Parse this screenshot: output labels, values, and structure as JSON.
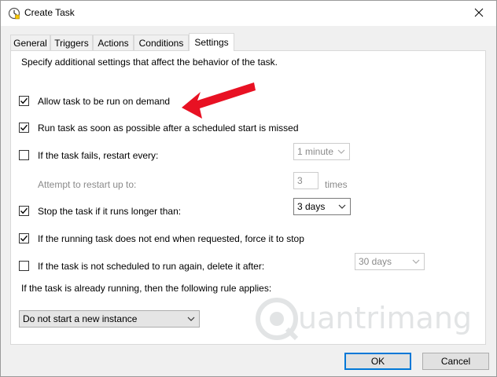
{
  "window": {
    "title": "Create Task",
    "title_icon": "clock-icon",
    "close_icon": "close-icon"
  },
  "tabs": [
    {
      "label": "General",
      "active": false
    },
    {
      "label": "Triggers",
      "active": false
    },
    {
      "label": "Actions",
      "active": false
    },
    {
      "label": "Conditions",
      "active": false
    },
    {
      "label": "Settings",
      "active": true
    }
  ],
  "settings": {
    "intro": "Specify additional settings that affect the behavior of the task.",
    "allow_on_demand": {
      "label": "Allow task to be run on demand",
      "checked": true
    },
    "run_asap": {
      "label": "Run task as soon as possible after a scheduled start is missed",
      "checked": true
    },
    "restart_on_fail": {
      "label": "If the task fails, restart every:",
      "checked": false,
      "interval": "1 minute"
    },
    "restart_attempts": {
      "label": "Attempt to restart up to:",
      "value": "3",
      "unit": "times"
    },
    "stop_if_longer": {
      "label": "Stop the task if it runs longer than:",
      "checked": true,
      "duration": "3 days"
    },
    "force_stop": {
      "label": "If the running task does not end when requested, force it to stop",
      "checked": true
    },
    "delete_if_not_scheduled": {
      "label": "If the task is not scheduled to run again, delete it after:",
      "checked": false,
      "duration": "30 days"
    },
    "rule_label": "If the task is already running, then the following rule applies:",
    "rule_value": "Do not start a new instance"
  },
  "buttons": {
    "ok": "OK",
    "cancel": "Cancel"
  },
  "annotation": {
    "arrow_color": "#e81123"
  },
  "watermark": {
    "text": "uantrimang",
    "icon": "q-logo-icon"
  }
}
